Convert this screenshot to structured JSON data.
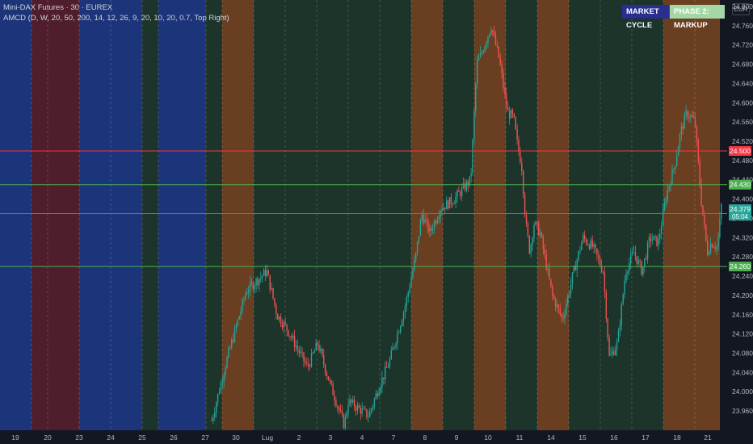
{
  "header": {
    "symbol_line": "Mini-DAX Futures · 30 · EUREX",
    "indicator_line": "AMCD (D, W, 20, 50, 200, 14, 12, 26, 9, 20, 10, 20, 0.7, Top Right)"
  },
  "badges": {
    "market_cycle": "MARKET CYCLE",
    "phase": "PHASE 2: MARKUP"
  },
  "currency": "EUR",
  "colors": {
    "background": "#131722",
    "up": "#26a69a",
    "down": "#ef5350",
    "resistance": "#f23645",
    "support": "#4caf50",
    "band_blue": "#1e3a8a",
    "band_red": "#5a1f2e",
    "band_green": "#1f3a2c",
    "band_orange": "#7a4520"
  },
  "chart_data": {
    "type": "candlestick",
    "ylim": [
      23940,
      24800
    ],
    "y_ticks": [
      "24.800",
      "24.760",
      "24.720",
      "24.680",
      "24.640",
      "24.600",
      "24.560",
      "24.520",
      "24.480",
      "24.440",
      "24.400",
      "24.360",
      "24.320",
      "24.280",
      "24.240",
      "24.200",
      "24.160",
      "24.120",
      "24.080",
      "24.040",
      "24.000",
      "23.960"
    ],
    "x_ticks": [
      "19",
      "20",
      "23",
      "24",
      "25",
      "26",
      "27",
      "30",
      "Lug",
      "2",
      "3",
      "4",
      "7",
      "8",
      "9",
      "10",
      "11",
      "14",
      "15",
      "16",
      "17",
      "18",
      "21"
    ],
    "day_boundaries": [
      0,
      39,
      59,
      98,
      137,
      176,
      196,
      255,
      275,
      314,
      353,
      392,
      431,
      470,
      509,
      548,
      587,
      626,
      665,
      704,
      743,
      782,
      821,
      860,
      891
    ],
    "day_bands": [
      "blue",
      "red",
      "red",
      "blue",
      "blue",
      "green",
      "blue",
      "green",
      "orange",
      "green",
      "green",
      "green",
      "green",
      "green",
      "orange",
      "green",
      "orange",
      "green",
      "orange",
      "green",
      "green",
      "green",
      "orange",
      "orange"
    ],
    "levels": [
      {
        "value": 24500,
        "label": "24.500",
        "kind": "resistance"
      },
      {
        "value": 24430,
        "label": "24.430",
        "kind": "support"
      },
      {
        "value": 24370,
        "label": "24.370",
        "kind": "resistance"
      },
      {
        "value": 24260,
        "label": "24.260",
        "kind": "support"
      }
    ],
    "last_price": {
      "value": 24379,
      "label": "24.379",
      "countdown": "05:04"
    },
    "price_path_points": [
      [
        26.3,
        23940
      ],
      [
        27,
        24060
      ],
      [
        28,
        24210
      ],
      [
        29,
        24250
      ],
      [
        29.5,
        24160
      ],
      [
        30,
        24130
      ],
      [
        31,
        24050
      ],
      [
        31.5,
        24100
      ],
      [
        32,
        24030
      ],
      [
        32.8,
        23930
      ],
      [
        33,
        23980
      ],
      [
        34,
        23950
      ],
      [
        34.5,
        24010
      ],
      [
        35,
        24060
      ],
      [
        35.8,
        24180
      ],
      [
        36.3,
        24280
      ],
      [
        36.6,
        24370
      ],
      [
        37,
        24330
      ],
      [
        37.5,
        24380
      ],
      [
        38.2,
        24400
      ],
      [
        39,
        24440
      ],
      [
        39.3,
        24680
      ],
      [
        39.6,
        24710
      ],
      [
        40,
        24760
      ],
      [
        40.4,
        24690
      ],
      [
        40.8,
        24580
      ],
      [
        41.1,
        24570
      ],
      [
        41.3,
        24510
      ],
      [
        41.5,
        24470
      ],
      [
        41.7,
        24350
      ],
      [
        41.9,
        24290
      ],
      [
        42.1,
        24350
      ],
      [
        42.4,
        24330
      ],
      [
        43,
        24200
      ],
      [
        43.5,
        24150
      ],
      [
        44,
        24240
      ],
      [
        44.5,
        24320
      ],
      [
        45,
        24300
      ],
      [
        45.5,
        24250
      ],
      [
        45.8,
        24070
      ],
      [
        46.2,
        24100
      ],
      [
        46.6,
        24250
      ],
      [
        47,
        24290
      ],
      [
        47.4,
        24250
      ],
      [
        47.8,
        24320
      ],
      [
        48.2,
        24310
      ],
      [
        48.6,
        24410
      ],
      [
        49,
        24470
      ],
      [
        49.3,
        24540
      ],
      [
        49.6,
        24580
      ],
      [
        50,
        24560
      ],
      [
        50.3,
        24400
      ],
      [
        50.6,
        24290
      ],
      [
        50.8,
        24310
      ],
      [
        51.1,
        24300
      ],
      [
        51.3,
        24390
      ]
    ],
    "candles_generated": true
  }
}
